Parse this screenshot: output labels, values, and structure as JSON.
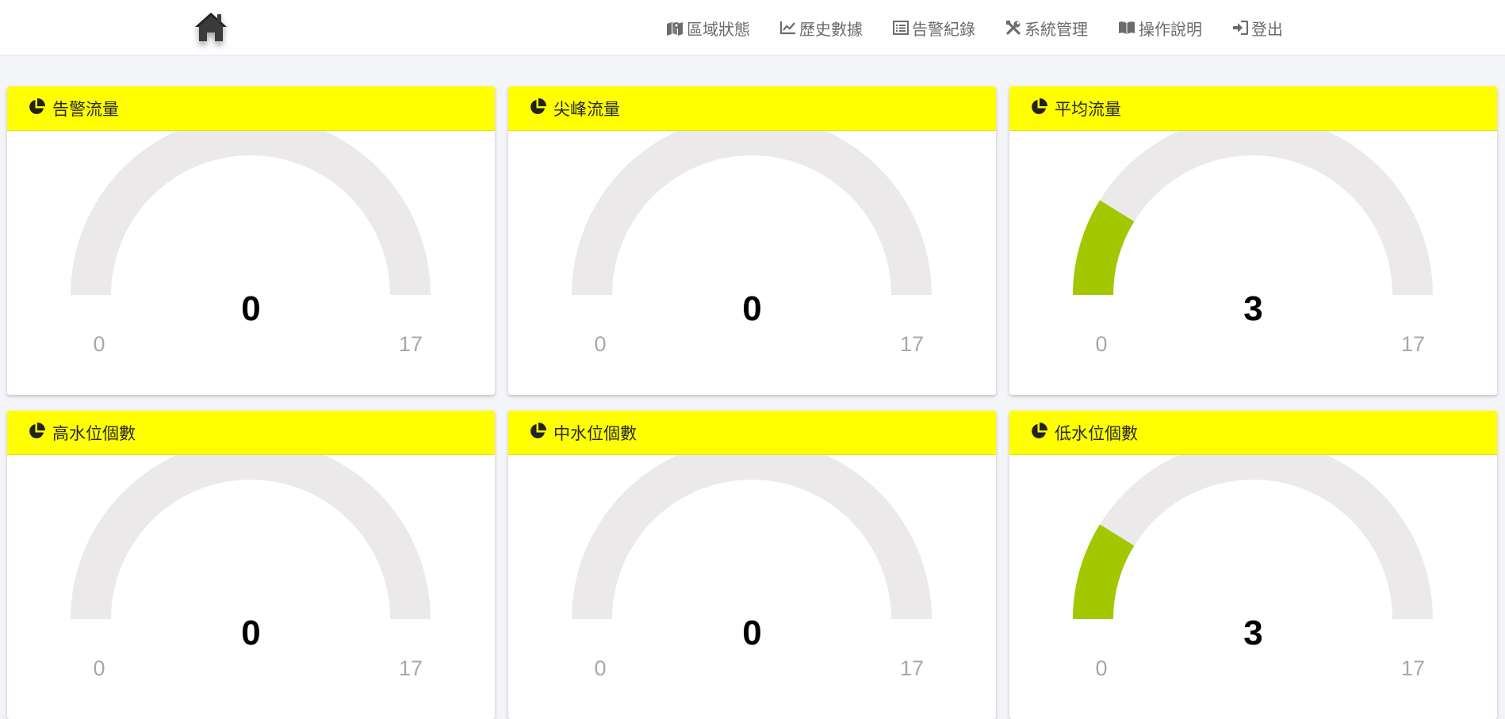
{
  "header": {
    "home_icon": "home-icon",
    "nav": [
      {
        "label": "區域狀態",
        "icon": "map-marker-icon"
      },
      {
        "label": "歷史數據",
        "icon": "line-chart-icon"
      },
      {
        "label": "告警紀錄",
        "icon": "list-icon"
      },
      {
        "label": "系統管理",
        "icon": "tools-icon"
      },
      {
        "label": "操作說明",
        "icon": "book-icon"
      },
      {
        "label": "登出",
        "icon": "sign-out-icon"
      }
    ]
  },
  "colors": {
    "header_bg": "#ffff00",
    "gauge_fill": "#a3c800",
    "gauge_track": "#ebe9e9",
    "page_bg": "#f4f5f9"
  },
  "gauges": [
    {
      "title": "告警流量",
      "icon": "pie-chart-icon",
      "value": "0",
      "min": "0",
      "max": "17",
      "level": 0
    },
    {
      "title": "尖峰流量",
      "icon": "pie-chart-icon",
      "value": "0",
      "min": "0",
      "max": "17",
      "level": 0
    },
    {
      "title": "平均流量",
      "icon": "pie-chart-icon",
      "value": "3",
      "min": "0",
      "max": "17",
      "level": 3
    },
    {
      "title": "高水位個數",
      "icon": "pie-chart-icon",
      "value": "0",
      "min": "0",
      "max": "17",
      "level": 0
    },
    {
      "title": "中水位個數",
      "icon": "pie-chart-icon",
      "value": "0",
      "min": "0",
      "max": "17",
      "level": 0
    },
    {
      "title": "低水位個數",
      "icon": "pie-chart-icon",
      "value": "3",
      "min": "0",
      "max": "17",
      "level": 3
    }
  ]
}
